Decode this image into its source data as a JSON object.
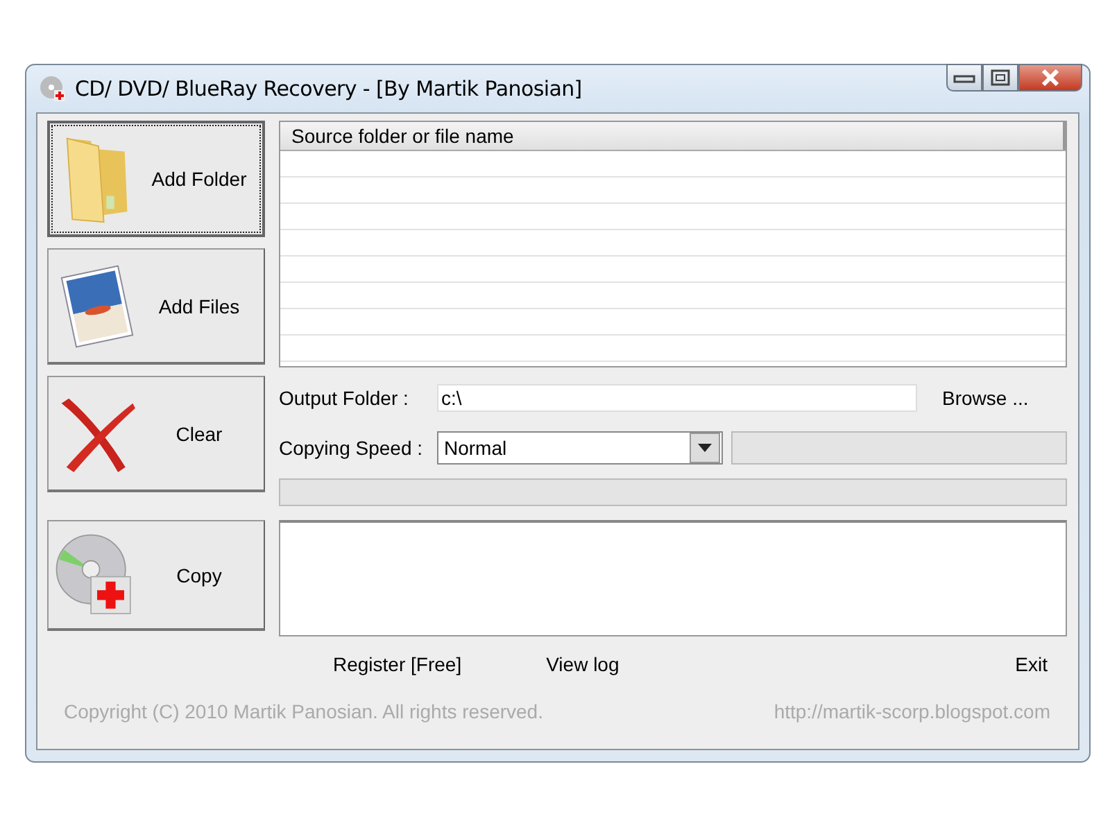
{
  "window": {
    "title": "CD/ DVD/ BlueRay Recovery - [By Martik Panosian]"
  },
  "side_buttons": [
    {
      "label": "Add Folder",
      "kind": "folder",
      "focused": true
    },
    {
      "label": "Add Files",
      "kind": "files",
      "focused": false
    },
    {
      "label": "Clear",
      "kind": "clear",
      "focused": false
    },
    {
      "label": "Copy",
      "kind": "copy",
      "focused": false
    }
  ],
  "source_list": {
    "columns": [
      "Source folder or file name"
    ]
  },
  "output_folder": {
    "label": "Output Folder :",
    "value": "c:\\",
    "button": "Browse ..."
  },
  "copying_speed": {
    "label": "Copying Speed :",
    "value": "Normal"
  },
  "progress": {
    "level": 0
  },
  "links": [
    "Register [Free]",
    "View log",
    "Exit"
  ],
  "footer": {
    "copyright": "Copyright (C) 2010 Martik Panosian. All rights reserved.",
    "url": "http://martik-scorp.blogspot.com"
  }
}
